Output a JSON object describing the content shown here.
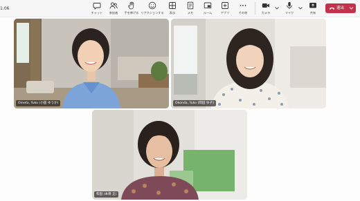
{
  "clock": "1:06",
  "toolbar": {
    "items": [
      {
        "label": "チャット",
        "icon": "chat-icon"
      },
      {
        "label": "参加者",
        "icon": "people-icon"
      },
      {
        "label": "手を挙げる",
        "icon": "raise-hand-icon"
      },
      {
        "label": "リアクションする",
        "icon": "reaction-icon"
      },
      {
        "label": "表示",
        "icon": "view-icon"
      },
      {
        "label": "メモ",
        "icon": "notes-icon"
      },
      {
        "label": "ルーム",
        "icon": "rooms-icon"
      },
      {
        "label": "アプリ",
        "icon": "apps-icon"
      },
      {
        "label": "その他",
        "icon": "more-icon"
      },
      {
        "label": "カメラ",
        "icon": "camera-icon"
      },
      {
        "label": "マイク",
        "icon": "mic-icon"
      },
      {
        "label": "共有",
        "icon": "share-icon"
      }
    ],
    "leave_label": "退出",
    "leave_color": "#c4314b"
  },
  "participants": [
    {
      "name": "Ometa, Yuko (小田 ゆうか)"
    },
    {
      "name": "Okonda, Yuko (岡田 ゆ子)"
    },
    {
      "name": "和田 (本導 正)"
    }
  ]
}
